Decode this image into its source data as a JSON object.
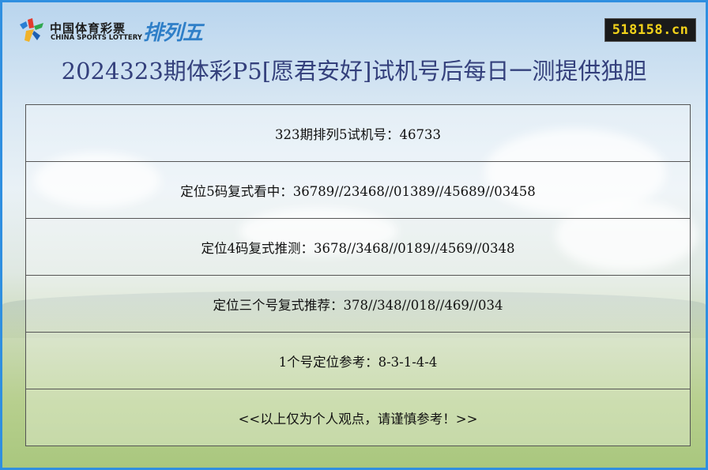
{
  "header": {
    "brand_cn": "中国体育彩票",
    "brand_en": "CHINA SPORTS LOTTERY",
    "game_name": "排列五",
    "site_badge": "518158.cn",
    "logo_icon": "sports-lottery-logo-icon"
  },
  "page": {
    "title": "2024323期体彩P5[愿君安好]试机号后每日一测提供独胆"
  },
  "rows": [
    {
      "text": "323期排列5试机号：46733"
    },
    {
      "text": "定位5码复式看中：36789//23468//01389//45689//03458"
    },
    {
      "text": "定位4码复式推测：3678//3468//0189//4569//0348"
    },
    {
      "text": "定位三个号复式推荐：378//348//018//469//034"
    },
    {
      "text": "1个号定位参考：8-3-1-4-4"
    },
    {
      "text": "<<以上仅为个人观点，请谨慎参考！>>"
    }
  ],
  "colors": {
    "frame_border": "#2f8fe0",
    "title": "#34407c",
    "game_name": "#2f7fc8",
    "badge_bg": "#1a1a1a",
    "badge_text": "#f2d21a"
  }
}
